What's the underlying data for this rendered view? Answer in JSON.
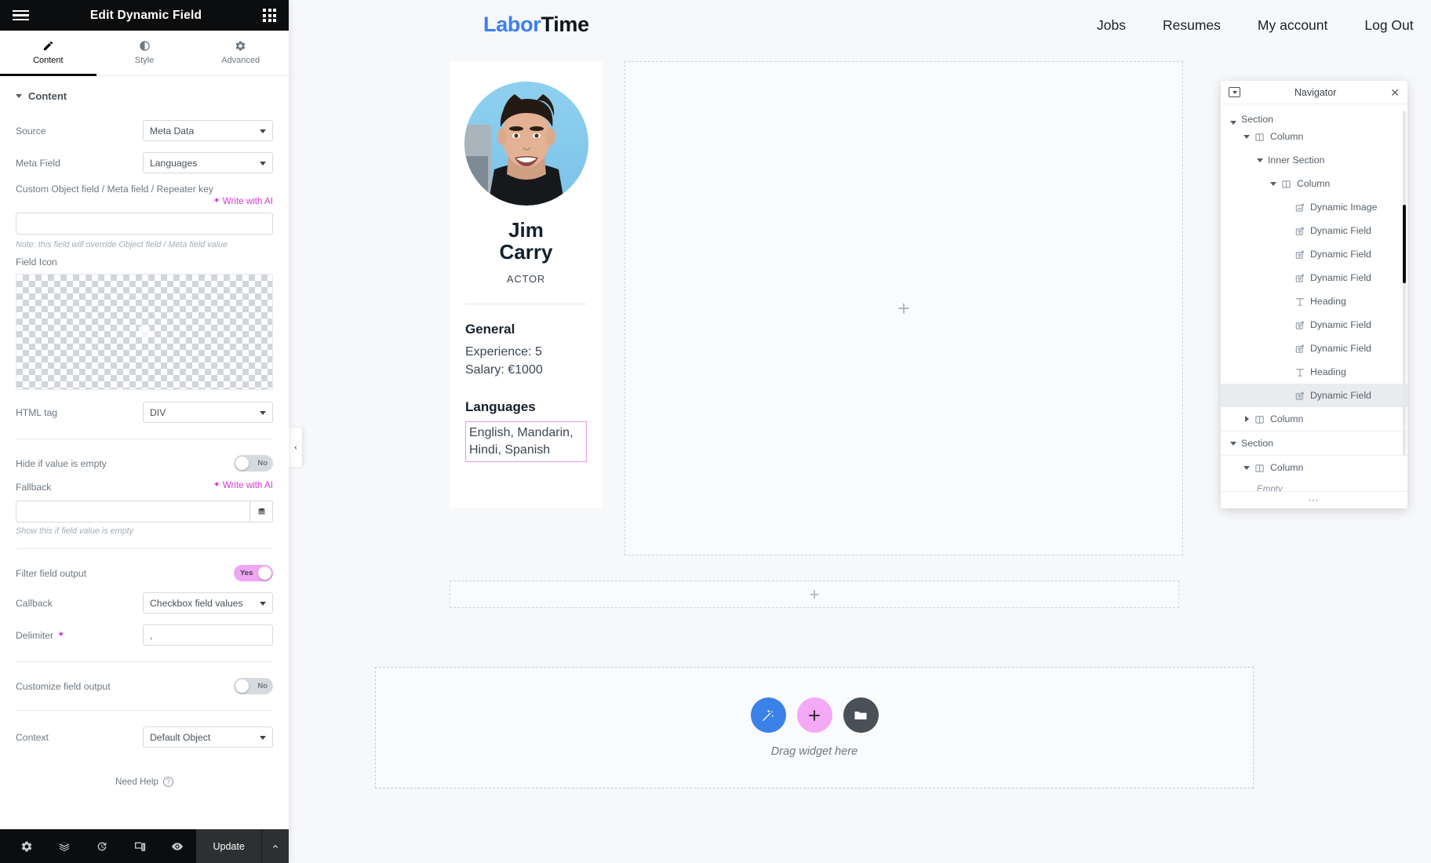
{
  "editor": {
    "header": {
      "title": "Edit Dynamic Field",
      "menu_icon": "hamburger-icon",
      "widgets_icon": "widgets-grid-icon"
    },
    "tabs": [
      {
        "label": "Content",
        "icon": "pencil-icon",
        "active": true
      },
      {
        "label": "Style",
        "icon": "contrast-icon",
        "active": false
      },
      {
        "label": "Advanced",
        "icon": "gear-icon",
        "active": false
      }
    ],
    "section": {
      "label": "Content"
    },
    "controls": {
      "source": {
        "label": "Source",
        "value": "Meta Data"
      },
      "meta_field": {
        "label": "Meta Field",
        "value": "Languages"
      },
      "custom_key": {
        "label": "Custom Object field / Meta field / Repeater key",
        "ai_label": "Write with AI",
        "value": "",
        "placeholder": "",
        "note": "Note: this field will override Object field / Meta field value"
      },
      "field_icon": {
        "label": "Field Icon"
      },
      "html_tag": {
        "label": "HTML tag",
        "value": "DIV"
      },
      "hide_if_empty": {
        "label": "Hide if value is empty",
        "value": "No",
        "on": false
      },
      "fallback": {
        "label": "Fallback",
        "ai_label": "Write with AI",
        "value": "",
        "placeholder": "",
        "hint": "Show this if field value is empty"
      },
      "filter_field_output": {
        "label": "Filter field output",
        "value": "Yes",
        "on": true
      },
      "callback": {
        "label": "Callback",
        "value": "Checkbox field values"
      },
      "delimiter": {
        "label": "Delimiter",
        "value": ","
      },
      "customize_field_output": {
        "label": "Customize field output",
        "value": "No",
        "on": false
      },
      "context": {
        "label": "Context",
        "value": "Default Object"
      }
    },
    "need_help": {
      "label": "Need Help"
    },
    "footer": {
      "icons": [
        "gear-icon",
        "layers-icon",
        "history-icon",
        "responsive-icon",
        "preview-eye-icon"
      ],
      "update_label": "Update",
      "caret_icon": "chevron-up-icon"
    },
    "collapse_handle_icon": "chevron-left-icon"
  },
  "site": {
    "brand": {
      "part1": "Labor",
      "part2": "Time",
      "color1": "#3b7ff5",
      "color2": "#111418"
    },
    "nav": [
      "Jobs",
      "Resumes",
      "My account",
      "Log Out"
    ]
  },
  "resume": {
    "name_line1": "Jim",
    "name_line2": "Carry",
    "role": "ACTOR",
    "general_heading": "General",
    "general_lines": "Experience: 5\nSalary: €1000",
    "experience_line": "Experience: 5",
    "salary_line": "Salary: €1000",
    "languages_heading": "Languages",
    "languages_value": "English, Mandarin, Hindi, Spanish",
    "selection_color": "#e79ae8"
  },
  "canvas": {
    "add_icon": "plus-icon",
    "add_section_icon": "plus-icon",
    "drop_area": {
      "hint": "Drag widget here",
      "buttons": [
        {
          "name": "magic-wand-icon",
          "color": "#3b82e8"
        },
        {
          "name": "plus-icon",
          "color": "#f4a9f6"
        },
        {
          "name": "folder-icon",
          "color": "#4a5058"
        }
      ]
    }
  },
  "navigator": {
    "title": "Navigator",
    "dock_icon": "dock-icon",
    "close_icon": "close-icon",
    "footer_icon": "more-dots-icon",
    "items": [
      {
        "label": "Section",
        "depth": 0,
        "twisty": "down",
        "icon": null,
        "selected": false,
        "partial": true
      },
      {
        "label": "Column",
        "depth": 1,
        "twisty": "down",
        "icon": "column-icon",
        "selected": false
      },
      {
        "label": "Inner Section",
        "depth": 2,
        "twisty": "down",
        "icon": null,
        "selected": false
      },
      {
        "label": "Column",
        "depth": 3,
        "twisty": "down",
        "icon": "column-icon",
        "selected": false
      },
      {
        "label": "Dynamic Image",
        "depth": 4,
        "twisty": null,
        "icon": "dynamic-image-icon",
        "selected": false
      },
      {
        "label": "Dynamic Field",
        "depth": 4,
        "twisty": null,
        "icon": "dynamic-field-icon",
        "selected": false
      },
      {
        "label": "Dynamic Field",
        "depth": 4,
        "twisty": null,
        "icon": "dynamic-field-icon",
        "selected": false
      },
      {
        "label": "Dynamic Field",
        "depth": 4,
        "twisty": null,
        "icon": "dynamic-field-icon",
        "selected": false
      },
      {
        "label": "Heading",
        "depth": 4,
        "twisty": null,
        "icon": "heading-icon",
        "selected": false
      },
      {
        "label": "Dynamic Field",
        "depth": 4,
        "twisty": null,
        "icon": "dynamic-field-icon",
        "selected": false
      },
      {
        "label": "Dynamic Field",
        "depth": 4,
        "twisty": null,
        "icon": "dynamic-field-icon",
        "selected": false
      },
      {
        "label": "Heading",
        "depth": 4,
        "twisty": null,
        "icon": "heading-icon",
        "selected": false
      },
      {
        "label": "Dynamic Field",
        "depth": 4,
        "twisty": null,
        "icon": "dynamic-field-icon",
        "selected": true
      },
      {
        "label": "Column",
        "depth": 1,
        "twisty": "right",
        "icon": "column-icon",
        "selected": false
      },
      {
        "label": "Section",
        "depth": 0,
        "twisty": "down",
        "icon": null,
        "selected": false
      },
      {
        "label": "Column",
        "depth": 1,
        "twisty": "down",
        "icon": "column-icon",
        "selected": false
      }
    ],
    "empty_label": "Empty"
  }
}
